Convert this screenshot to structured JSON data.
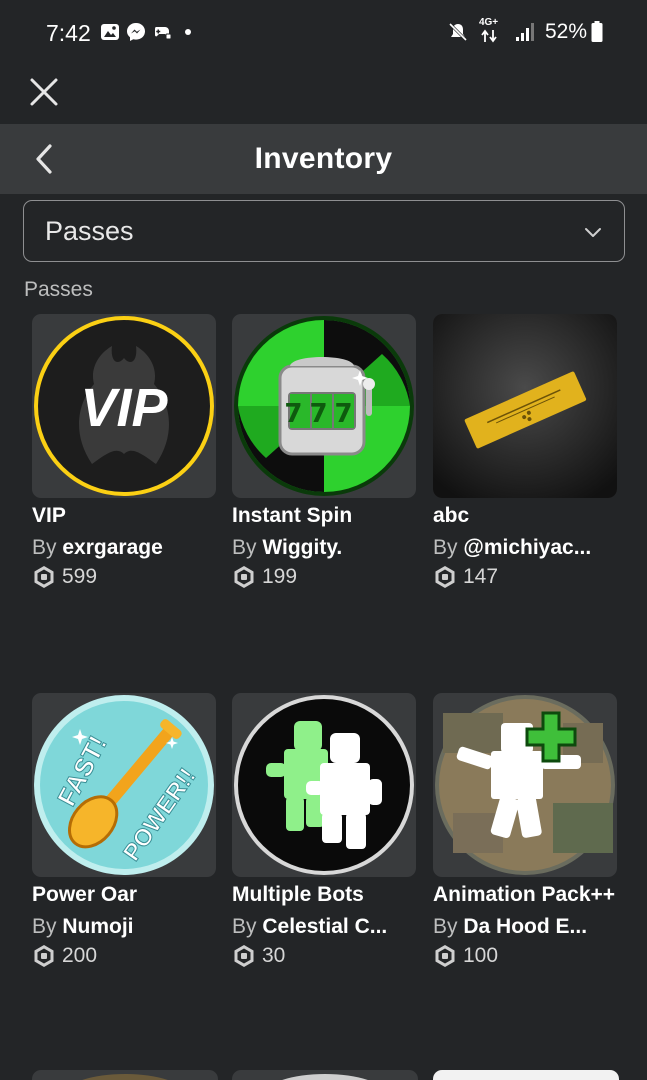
{
  "status_bar": {
    "time": "7:42",
    "network": "4G+",
    "battery": "52%",
    "icons": [
      "gallery-icon",
      "messenger-icon",
      "game-controller-icon",
      "dot-icon",
      "mute-icon",
      "data-arrows-icon",
      "signal-icon",
      "battery-icon"
    ]
  },
  "header": {
    "title": "Inventory"
  },
  "category_select": {
    "value": "Passes"
  },
  "section": {
    "label": "Passes"
  },
  "passes": [
    {
      "name": "VIP",
      "by": "By",
      "creator": "exrgarage",
      "price": "599"
    },
    {
      "name": "Instant Spin",
      "by": "By",
      "creator": "Wiggity.",
      "price": "199"
    },
    {
      "name": "abc",
      "by": "By",
      "creator": "@michiyac...",
      "price": "147"
    },
    {
      "name": "Power Oar",
      "by": "By",
      "creator": "Numoji",
      "price": "200"
    },
    {
      "name": "Multiple Bots",
      "by": "By",
      "creator": "Celestial C...",
      "price": "30"
    },
    {
      "name": "Animation Pack++",
      "by": "By",
      "creator": "Da Hood E...",
      "price": "100"
    }
  ],
  "thumbnail_art": {
    "vip": "VIP",
    "power_oar_top": "FAST!",
    "power_oar_bottom": "POWER!!",
    "slot_digits": "777"
  },
  "colors": {
    "background": "#232527",
    "header_bg": "#393b3d",
    "card_bg": "#393b3d",
    "text_primary": "#ffffff",
    "text_secondary": "#bdbebe"
  }
}
